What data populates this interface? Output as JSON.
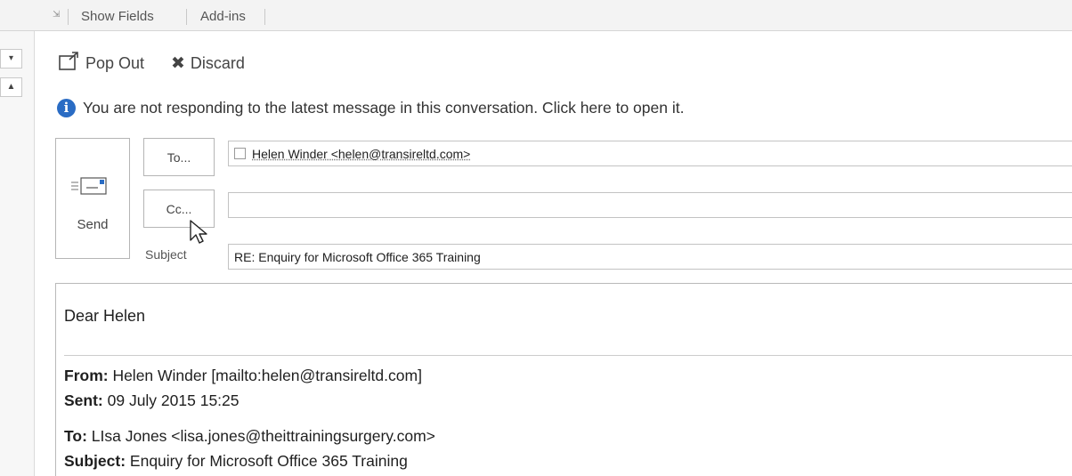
{
  "ribbon": {
    "items": [
      "Show Fields",
      "Add-ins"
    ]
  },
  "actions": {
    "pop_out": "Pop Out",
    "discard": "Discard"
  },
  "info_banner": {
    "text": "You are not responding to the latest message in this conversation. Click here to open it."
  },
  "compose": {
    "send_label": "Send",
    "to_label": "To...",
    "cc_label": "Cc...",
    "subject_label": "Subject",
    "to_value": "Helen Winder <helen@transireltd.com>",
    "cc_value": "",
    "subject_value": "RE: Enquiry for Microsoft Office 365 Training"
  },
  "body": {
    "greeting": "Dear Helen",
    "quoted_header": [
      {
        "label": "From:",
        "value": " Helen Winder [mailto:helen@transireltd.com]"
      },
      {
        "label": "Sent:",
        "value": " 09 July 2015 15:25"
      },
      {
        "label": "To:",
        "value": " LIsa Jones <lisa.jones@theittrainingsurgery.com>"
      },
      {
        "label": "Subject:",
        "value": " Enquiry for Microsoft Office 365 Training"
      }
    ]
  },
  "icons": {
    "pop_out": "pop-out-icon",
    "discard": "close-x-icon",
    "info": "info-icon",
    "send": "envelope-icon",
    "cursor": "mouse-pointer-icon"
  },
  "colors": {
    "info_blue": "#2a6cc4",
    "envelope_blue": "#2a6cc4"
  }
}
